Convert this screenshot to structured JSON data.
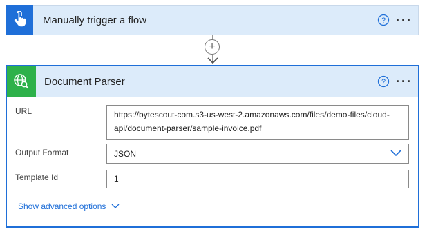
{
  "trigger": {
    "title": "Manually trigger a flow",
    "icon": "touch-hand-icon",
    "more_label": "···"
  },
  "connector": {
    "add_label": "+"
  },
  "action": {
    "title": "Document Parser",
    "icon": "globe-search-icon",
    "more_label": "···",
    "fields": {
      "url": {
        "label": "URL",
        "value": "https://bytescout-com.s3-us-west-2.amazonaws.com/files/demo-files/cloud-api/document-parser/sample-invoice.pdf"
      },
      "output_format": {
        "label": "Output Format",
        "value": "JSON"
      },
      "template_id": {
        "label": "Template Id",
        "value": "1"
      }
    },
    "advanced_label": "Show advanced options"
  },
  "colors": {
    "header_bg": "#dcebfa",
    "trigger_icon_bg": "#1f6fd8",
    "action_icon_bg": "#2db14a",
    "accent": "#1f6fd8"
  }
}
